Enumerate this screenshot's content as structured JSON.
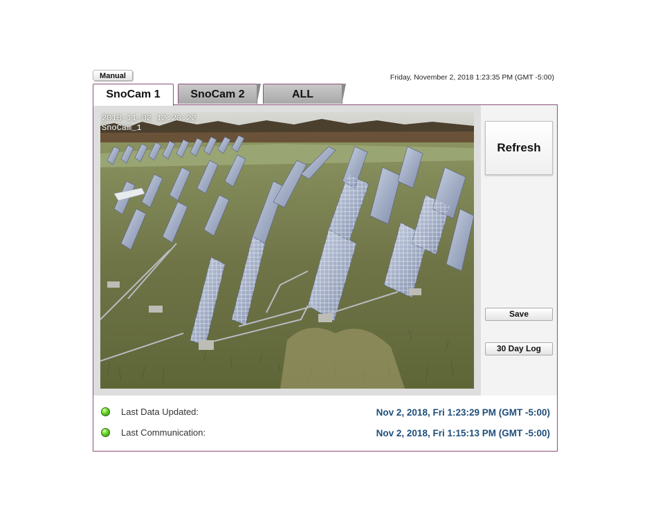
{
  "manual_label": "Manual",
  "header_datetime": "Friday, November 2, 2018 1:23:35 PM (GMT -5:00)",
  "tabs": [
    {
      "label": "SnoCam 1"
    },
    {
      "label": "SnoCam 2"
    },
    {
      "label": "ALL"
    }
  ],
  "camera": {
    "timestamp": "2018-11-02 12:23:22",
    "name": "SnoCam_1"
  },
  "buttons": {
    "refresh": "Refresh",
    "save": "Save",
    "log": "30 Day Log"
  },
  "status": [
    {
      "label": "Last Data Updated:",
      "value": "Nov 2, 2018, Fri 1:23:29 PM (GMT -5:00)"
    },
    {
      "label": "Last Communication:",
      "value": "Nov 2, 2018, Fri 1:15:13 PM (GMT -5:00)"
    }
  ]
}
